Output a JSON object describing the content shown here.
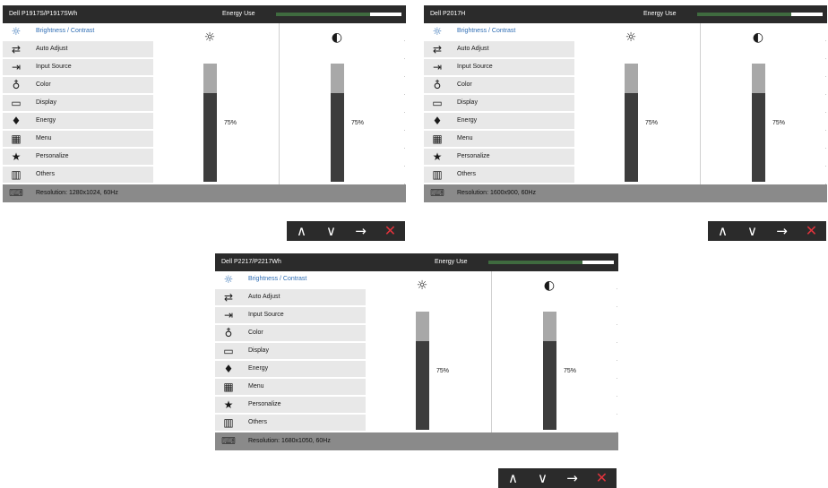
{
  "osds": [
    {
      "model": "Dell P1917S/P1917SWh",
      "energy_label": "Energy Use",
      "energy_level": 0.75,
      "menu": [
        {
          "label": "Brightness / Contrast",
          "icon": "brightness-icon",
          "glyph": "☼",
          "active": true
        },
        {
          "label": "Auto Adjust",
          "icon": "auto-adjust-icon",
          "glyph": "⇄",
          "active": false
        },
        {
          "label": "Input Source",
          "icon": "input-source-icon",
          "glyph": "⇥",
          "active": false
        },
        {
          "label": "Color",
          "icon": "color-icon",
          "glyph": "♁",
          "active": false
        },
        {
          "label": "Display",
          "icon": "display-icon",
          "glyph": "▭",
          "active": false
        },
        {
          "label": "Energy",
          "icon": "energy-icon",
          "glyph": "♦",
          "active": false
        },
        {
          "label": "Menu",
          "icon": "menu-icon",
          "glyph": "▦",
          "active": false
        },
        {
          "label": "Personalize",
          "icon": "star-icon",
          "glyph": "★",
          "active": false
        },
        {
          "label": "Others",
          "icon": "others-icon",
          "glyph": "▥",
          "active": false
        }
      ],
      "brightness": {
        "value_label": "75%",
        "level": 0.75,
        "icon": "sun-icon",
        "glyph": "☼"
      },
      "contrast": {
        "value_label": "75%",
        "level": 0.75,
        "icon": "contrast-icon",
        "glyph": "◐"
      },
      "resolution": "Resolution: 1280x1024, 60Hz"
    },
    {
      "model": "Dell P2017H",
      "energy_label": "Energy Use",
      "energy_level": 0.75,
      "menu": [
        {
          "label": "Brightness / Contrast",
          "icon": "brightness-icon",
          "glyph": "☼",
          "active": true
        },
        {
          "label": "Auto Adjust",
          "icon": "auto-adjust-icon",
          "glyph": "⇄",
          "active": false
        },
        {
          "label": "Input Source",
          "icon": "input-source-icon",
          "glyph": "⇥",
          "active": false
        },
        {
          "label": "Color",
          "icon": "color-icon",
          "glyph": "♁",
          "active": false
        },
        {
          "label": "Display",
          "icon": "display-icon",
          "glyph": "▭",
          "active": false
        },
        {
          "label": "Energy",
          "icon": "energy-icon",
          "glyph": "♦",
          "active": false
        },
        {
          "label": "Menu",
          "icon": "menu-icon",
          "glyph": "▦",
          "active": false
        },
        {
          "label": "Personalize",
          "icon": "star-icon",
          "glyph": "★",
          "active": false
        },
        {
          "label": "Others",
          "icon": "others-icon",
          "glyph": "▥",
          "active": false
        }
      ],
      "brightness": {
        "value_label": "75%",
        "level": 0.75,
        "icon": "sun-icon",
        "glyph": "☼"
      },
      "contrast": {
        "value_label": "75%",
        "level": 0.75,
        "icon": "contrast-icon",
        "glyph": "◐"
      },
      "resolution": "Resolution: 1600x900, 60Hz"
    },
    {
      "model": "Dell P2217/P2217Wh",
      "energy_label": "Energy Use",
      "energy_level": 0.75,
      "menu": [
        {
          "label": "Brightness / Contrast",
          "icon": "brightness-icon",
          "glyph": "☼",
          "active": true
        },
        {
          "label": "Auto Adjust",
          "icon": "auto-adjust-icon",
          "glyph": "⇄",
          "active": false
        },
        {
          "label": "Input Source",
          "icon": "input-source-icon",
          "glyph": "⇥",
          "active": false
        },
        {
          "label": "Color",
          "icon": "color-icon",
          "glyph": "♁",
          "active": false
        },
        {
          "label": "Display",
          "icon": "display-icon",
          "glyph": "▭",
          "active": false
        },
        {
          "label": "Energy",
          "icon": "energy-icon",
          "glyph": "♦",
          "active": false
        },
        {
          "label": "Menu",
          "icon": "menu-icon",
          "glyph": "▦",
          "active": false
        },
        {
          "label": "Personalize",
          "icon": "star-icon",
          "glyph": "★",
          "active": false
        },
        {
          "label": "Others",
          "icon": "others-icon",
          "glyph": "▥",
          "active": false
        }
      ],
      "brightness": {
        "value_label": "75%",
        "level": 0.75,
        "icon": "sun-icon",
        "glyph": "☼"
      },
      "contrast": {
        "value_label": "75%",
        "level": 0.75,
        "icon": "contrast-icon",
        "glyph": "◐"
      },
      "resolution": "Resolution: 1680x1050, 60Hz"
    }
  ],
  "nav_buttons": [
    {
      "name": "up-arrow-icon",
      "glyph": "∧"
    },
    {
      "name": "down-arrow-icon",
      "glyph": "∨"
    },
    {
      "name": "right-arrow-icon",
      "glyph": "→"
    },
    {
      "name": "close-icon",
      "glyph": "✕"
    }
  ],
  "colors": {
    "header_bg": "#2b2b2b",
    "active_accent": "#2e6db4",
    "energy_fill": "#3f6b3f",
    "close_red": "#e0333c",
    "footer_bg": "#8a8a8a"
  }
}
